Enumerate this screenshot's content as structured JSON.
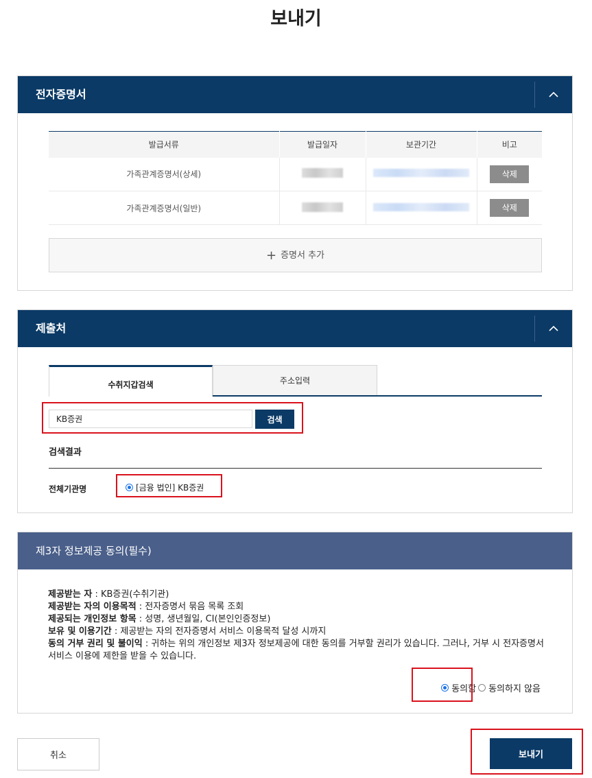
{
  "page": {
    "title": "보내기"
  },
  "certificates": {
    "title": "전자증명서",
    "columns": [
      "발급서류",
      "발급일자",
      "보관기간",
      "비고"
    ],
    "rows": [
      {
        "doc": "가족관계증명서(상세)",
        "action": "삭제"
      },
      {
        "doc": "가족관계증명서(일반)",
        "action": "삭제"
      }
    ],
    "add_label": "증명서 추가"
  },
  "submission": {
    "title": "제출처",
    "tabs": [
      "수취지갑검색",
      "주소입력"
    ],
    "search_value": "KB증권",
    "search_button": "검색",
    "results_title": "검색결과",
    "org_label": "전체기관명",
    "org_option": "[금융 법인] KB증권"
  },
  "consent": {
    "title": "제3자 정보제공 동의(필수)",
    "lines": [
      {
        "label": "제공받는 자",
        "text": " : KB증권(수취기관)"
      },
      {
        "label": "제공받는 자의 이용목적",
        "text": " : 전자증명서 묶음 목록 조회"
      },
      {
        "label": "제공되는 개인정보 항목",
        "text": " : 성명, 생년월일, CI(본인인증정보)"
      },
      {
        "label": "보유 및 이용기간",
        "text": " : 제공받는 자의 전자증명서 서비스 이용목적 달성 시까지"
      },
      {
        "label": "동의 거부 권리 및 불이익",
        "text": " : 귀하는 위의 개인정보 제3자 정보제공에 대한 동의를 거부할 권리가 있습니다. 그러나, 거부 시 전자증명서 서비스 이용에 제한을 받을 수 있습니다."
      }
    ],
    "agree": "동의함",
    "disagree": "동의하지 않음"
  },
  "footer": {
    "cancel": "취소",
    "send": "보내기"
  },
  "colors": {
    "primary": "#0b3a66",
    "consent_header": "#4a5f8a",
    "highlight": "#d9111c",
    "radio": "#1a73e8"
  }
}
